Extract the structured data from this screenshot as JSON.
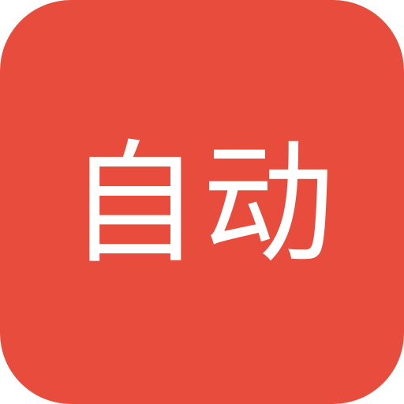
{
  "icon": {
    "label": "自动",
    "background_color": "#E74C3C",
    "text_color": "#FFFFFF"
  }
}
